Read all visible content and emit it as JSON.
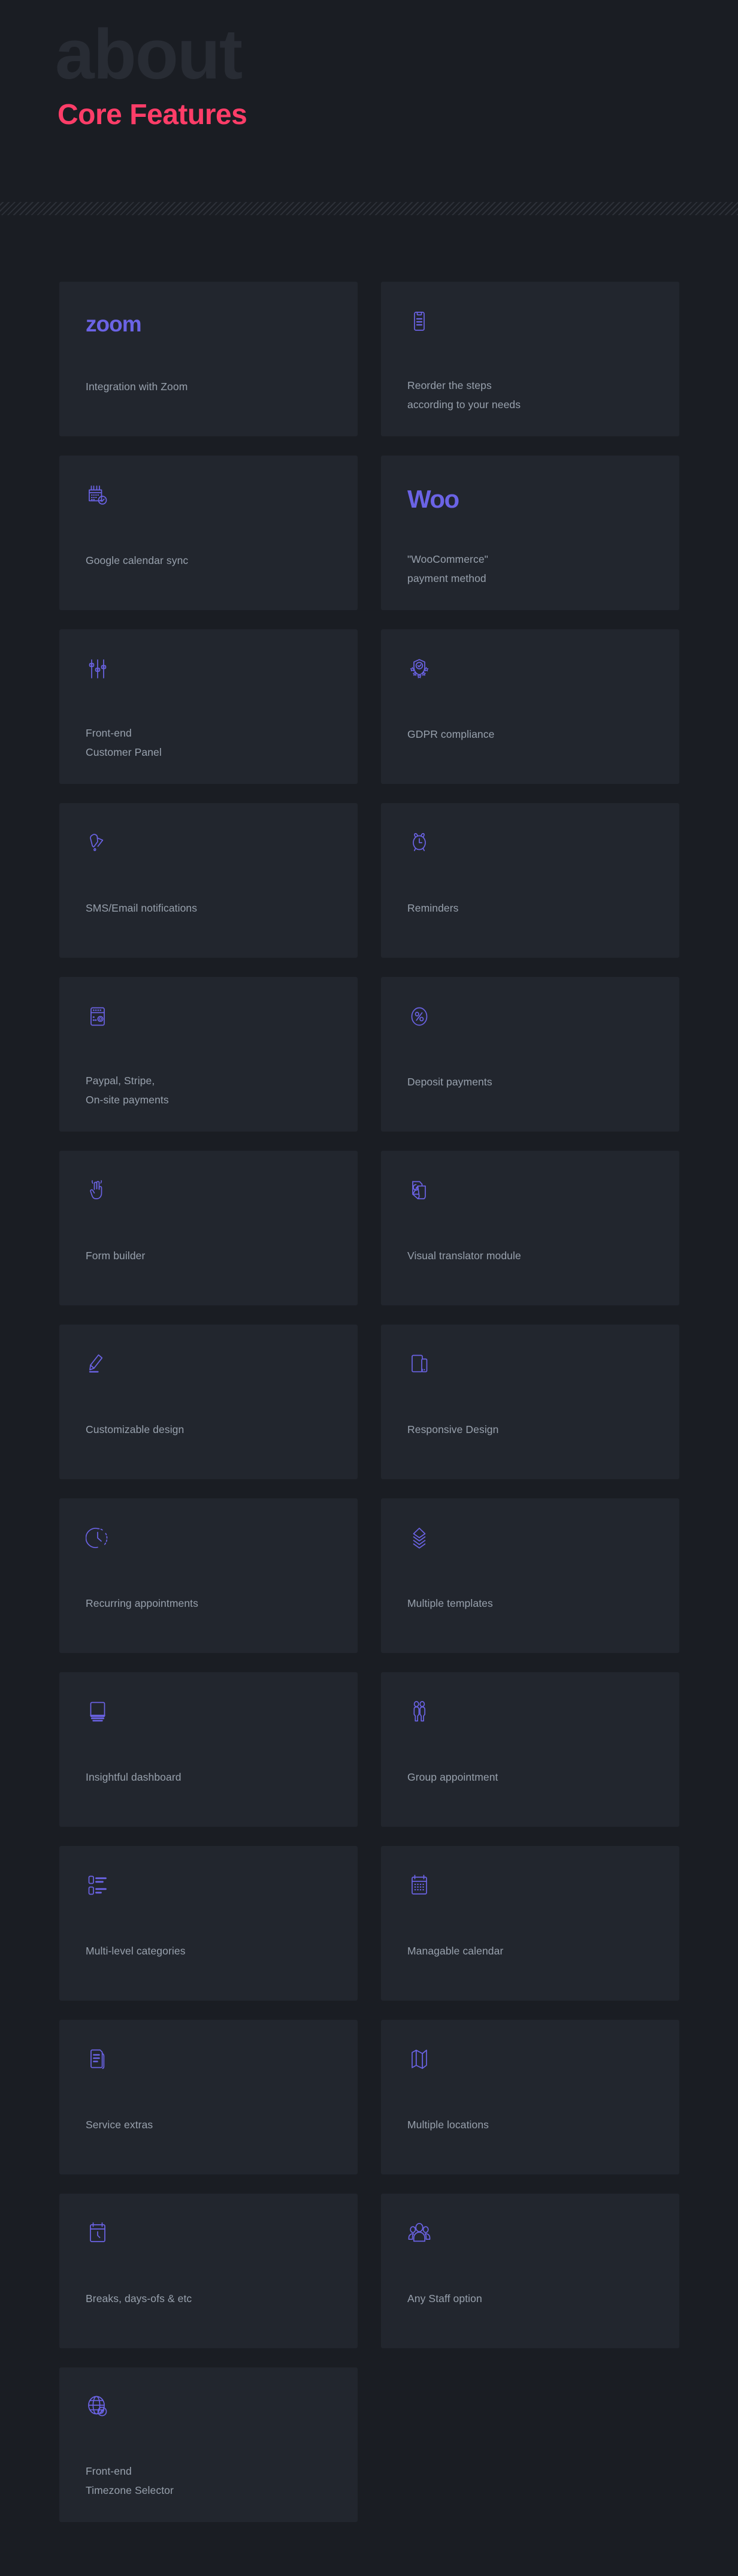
{
  "theme": {
    "page_bg": "#1a1d23",
    "card_bg": "#22262e",
    "accent_purple": "#6b63e5",
    "accent_pink": "#ff3d68",
    "text_muted": "#98a1ad",
    "ghost_text": "#282c34"
  },
  "hero": {
    "ghost_title": "about",
    "title": "Core Features"
  },
  "features": [
    {
      "icon": "zoom-wordmark",
      "label": "Integration with Zoom",
      "lines": 1
    },
    {
      "icon": "reorder-steps-icon",
      "label": "Reorder the steps\naccording to your needs",
      "lines": 2
    },
    {
      "icon": "google-calendar-sync-icon",
      "label": "Google calendar sync",
      "lines": 1
    },
    {
      "icon": "woo-wordmark",
      "label": "\"WooCommerce\"\npayment method",
      "lines": 2
    },
    {
      "icon": "sliders-icon",
      "label": "Front-end\nCustomer Panel",
      "lines": 2
    },
    {
      "icon": "gdpr-shield-icon",
      "label": "GDPR compliance",
      "lines": 1
    },
    {
      "icon": "chat-notification-icon",
      "label": "SMS/Email notifications",
      "lines": 1
    },
    {
      "icon": "alarm-clock-icon",
      "label": "Reminders",
      "lines": 1
    },
    {
      "icon": "card-terminal-icon",
      "label": "Paypal, Stripe,\nOn-site payments",
      "lines": 2
    },
    {
      "icon": "percent-circle-icon",
      "label": "Deposit payments",
      "lines": 1
    },
    {
      "icon": "hand-gesture-icon",
      "label": "Form builder",
      "lines": 1
    },
    {
      "icon": "translate-pages-icon",
      "label": "Visual translator module",
      "lines": 1
    },
    {
      "icon": "marker-pen-icon",
      "label": "Customizable design",
      "lines": 1
    },
    {
      "icon": "devices-icon",
      "label": "Responsive Design",
      "lines": 1
    },
    {
      "icon": "clock-dashed-icon",
      "label": "Recurring appointments",
      "lines": 1
    },
    {
      "icon": "layers-icon",
      "label": "Multiple templates",
      "lines": 1
    },
    {
      "icon": "monitor-icon",
      "label": "Insightful dashboard",
      "lines": 1
    },
    {
      "icon": "two-people-icon",
      "label": "Group appointment",
      "lines": 1
    },
    {
      "icon": "list-categories-icon",
      "label": "Multi-level categories",
      "lines": 1
    },
    {
      "icon": "calendar-icon",
      "label": "Managable calendar",
      "lines": 1
    },
    {
      "icon": "documents-icon",
      "label": "Service extras",
      "lines": 1
    },
    {
      "icon": "folded-map-icon",
      "label": "Multiple locations",
      "lines": 1
    },
    {
      "icon": "calendar-clock-icon",
      "label": "Breaks, days-ofs & etc",
      "lines": 1
    },
    {
      "icon": "group-people-icon",
      "label": "Any Staff option",
      "lines": 1
    },
    {
      "icon": "globe-compass-icon",
      "label": "Front-end\nTimezone Selector",
      "lines": 2
    }
  ]
}
